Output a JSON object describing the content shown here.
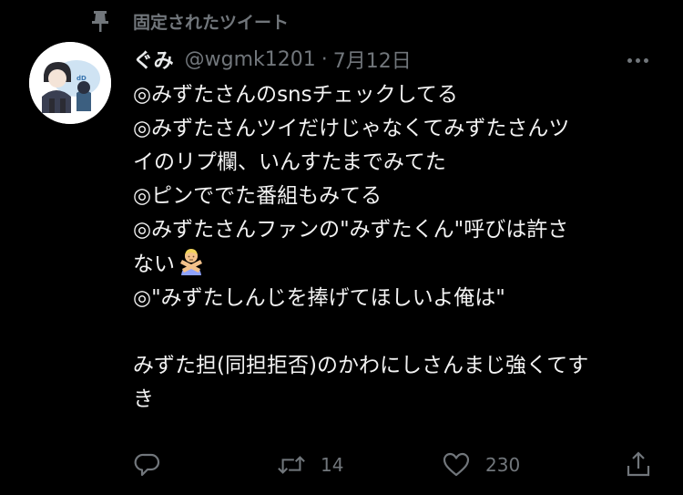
{
  "pinned": {
    "label": "固定されたツイート",
    "icon": "pin-icon"
  },
  "tweet": {
    "author": {
      "display_name": "ぐみ",
      "handle": "@wgmk1201",
      "avatar_icon": "avatar-illustration"
    },
    "separator": "·",
    "date": "7月12日",
    "lines": [
      "◎みずたさんのsnsチェックしてる",
      "◎みずたさんツイだけじゃなくてみずたさんツ",
      "イのリプ欄、いんすたまでみてた",
      "◎ピンででた番組もみてる",
      "◎みずたさんファンの\"みずたくん\"呼びは許さ",
      "ない",
      "◎\"みずたしんじを捧げてほしいよ俺は\"",
      "",
      "みずた担(同担拒否)のかわにしさんまじ強くてす",
      "き"
    ],
    "emoji": "person-gesturing-no-emoji"
  },
  "actions": {
    "reply": {
      "icon": "reply-icon"
    },
    "retweet": {
      "icon": "retweet-icon",
      "count": "14"
    },
    "like": {
      "icon": "heart-icon",
      "count": "230"
    },
    "share": {
      "icon": "share-icon"
    }
  },
  "colors": {
    "background": "#000000",
    "text_primary": "#e7e9ea",
    "text_secondary": "#71767b"
  }
}
